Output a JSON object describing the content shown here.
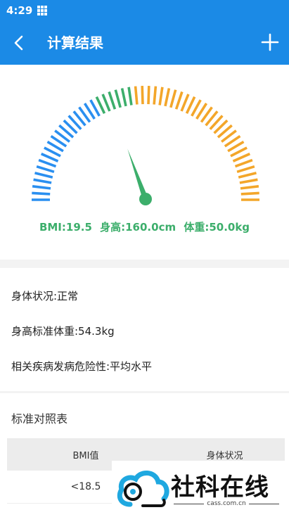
{
  "status": {
    "time": "4:29"
  },
  "header": {
    "title": "计算结果"
  },
  "gauge": {
    "needle_fraction": 0.39,
    "colors": {
      "blue": "#2a8ff0",
      "green": "#3cae6b",
      "orange": "#f3a62a"
    }
  },
  "readout": {
    "bmi": "BMI:19.5",
    "height": "身高:160.0cm",
    "weight": "体重:50.0kg"
  },
  "info": {
    "status": "身体状况:正常",
    "std_weight": "身高标准体重:54.3kg",
    "risk": "相关疾病发病危险性:平均水平"
  },
  "table": {
    "title": "标准对照表",
    "headers": [
      "BMI值",
      "身体状况"
    ],
    "rows": [
      [
        "<18.5",
        ""
      ]
    ]
  },
  "watermark": {
    "text": "社科在线",
    "url": "cass.com.cn"
  }
}
